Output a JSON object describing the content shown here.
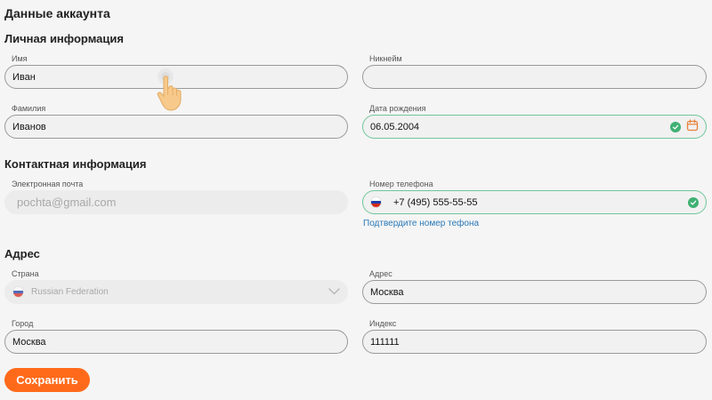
{
  "page": {
    "title": "Данные аккаунта"
  },
  "personal": {
    "title": "Личная информация",
    "first_name": {
      "label": "Имя",
      "value": "Иван"
    },
    "nickname": {
      "label": "Никнейм",
      "value": ""
    },
    "last_name": {
      "label": "Фамилия",
      "value": "Иванов"
    },
    "birth_date": {
      "label": "Дата рождения",
      "value": "06.05.2004"
    }
  },
  "contact": {
    "title": "Контактная информация",
    "email": {
      "label": "Электронная почта",
      "value": "pochta@gmail.com"
    },
    "phone": {
      "label": "Номер телефона",
      "value": "+7 (495) 555-55-55"
    },
    "confirm_phone_link": "Подтвердите номер тефона"
  },
  "address": {
    "title": "Адрес",
    "country": {
      "label": "Страна",
      "value": "Russian Federation"
    },
    "street": {
      "label": "Адрес",
      "value": "Москва"
    },
    "city": {
      "label": "Город",
      "value": "Москва"
    },
    "zip": {
      "label": "Индекс",
      "value": "111111"
    }
  },
  "actions": {
    "save_label": "Сохранить"
  },
  "colors": {
    "accent": "#ff6a1a",
    "valid": "#3fb073",
    "link": "#2a78b8",
    "calendar": "#e8823a"
  },
  "icons": [
    "check-icon",
    "calendar-icon",
    "flag-ru-icon",
    "chevron-down-icon",
    "hand-pointer-icon"
  ]
}
